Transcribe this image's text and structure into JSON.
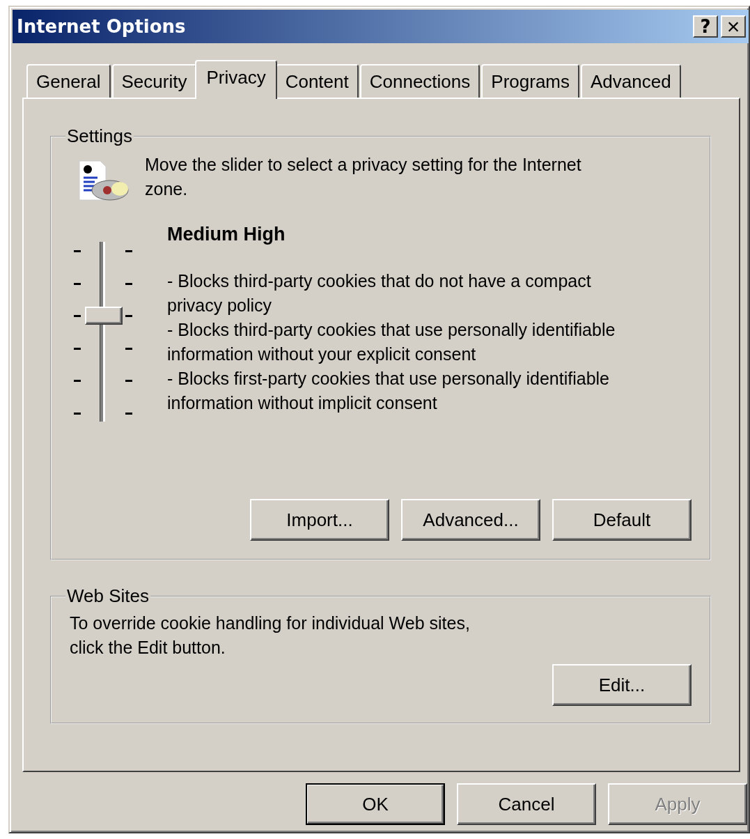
{
  "window": {
    "title": "Internet Options",
    "title_buttons": [
      {
        "kind": "help",
        "label": "?"
      },
      {
        "kind": "close",
        "label": "×"
      }
    ]
  },
  "tabs": [
    {
      "label": "General",
      "selected": false
    },
    {
      "label": "Security",
      "selected": false
    },
    {
      "label": "Privacy",
      "selected": true
    },
    {
      "label": "Content",
      "selected": false
    },
    {
      "label": "Connections",
      "selected": false
    },
    {
      "label": "Programs",
      "selected": false
    },
    {
      "label": "Advanced",
      "selected": false
    }
  ],
  "settings": {
    "title": "Settings",
    "intro_lines": [
      "Move the slider to select a privacy setting for the Internet",
      "zone."
    ],
    "slider": {
      "level": 0.6
    },
    "level_name": "Medium High",
    "description": [
      "- Blocks third-party cookies that do not have a compact privacy policy",
      "- Blocks third-party cookies that use personally identifiable information without your explicit consent",
      "- Blocks first-party cookies that use personally identifiable information without implicit consent"
    ],
    "buttons": [
      {
        "label": "Import...",
        "disabled": false
      },
      {
        "label": "Advanced...",
        "disabled": false
      },
      {
        "label": "Default",
        "disabled": false
      }
    ]
  },
  "web_sites": {
    "title": "Web Sites",
    "lines": [
      "To override cookie handling for individual Web sites,",
      "click the Edit button."
    ],
    "buttons": [
      {
        "label": "Edit...",
        "disabled": false
      }
    ]
  },
  "footer_buttons": [
    {
      "label": "OK",
      "default": true,
      "disabled": false
    },
    {
      "label": "Cancel",
      "default": false,
      "disabled": false
    },
    {
      "label": "Apply",
      "default": false,
      "disabled": true
    }
  ]
}
